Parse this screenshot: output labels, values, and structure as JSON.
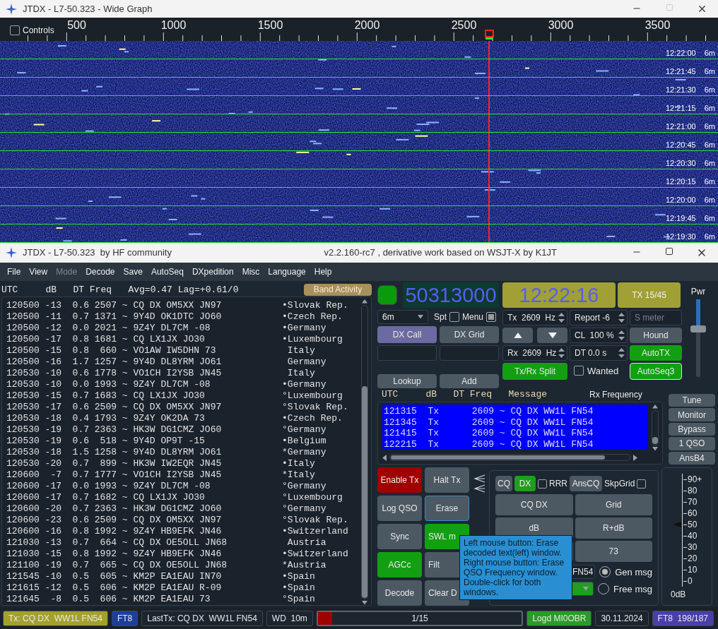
{
  "wide_graph": {
    "title": "JTDX - L7-50.323 - Wide Graph",
    "controls": {
      "label": "Controls",
      "checked": false
    },
    "scale_labels": [
      "500",
      "1000",
      "1500",
      "2000",
      "2500",
      "3000",
      "3500"
    ],
    "time_rows": [
      {
        "time": "12:22:00",
        "band": "6m"
      },
      {
        "time": "12:21:45",
        "band": "6m"
      },
      {
        "time": "12:21:30",
        "band": "6m"
      },
      {
        "time": "12:21:15",
        "band": "6m"
      },
      {
        "time": "12:21:00",
        "band": "6m"
      },
      {
        "time": "12:20:45",
        "band": "6m"
      },
      {
        "time": "12:20:30",
        "band": "6m"
      },
      {
        "time": "12:20:15",
        "band": "6m"
      },
      {
        "time": "12:20:00",
        "band": "6m"
      },
      {
        "time": "12:19:45",
        "band": "6m"
      },
      {
        "time": "12:19:30",
        "band": "6m"
      }
    ]
  },
  "main_window": {
    "title": "JTDX - L7-50.323  by HF community",
    "subtitle": "v2.2.160-rc7 , derivative work based on WSJT-X by K1JT"
  },
  "menu": [
    {
      "label": "File",
      "disabled": false
    },
    {
      "label": "View",
      "disabled": false
    },
    {
      "label": "Mode",
      "disabled": true
    },
    {
      "label": "Decode",
      "disabled": false
    },
    {
      "label": "Save",
      "disabled": false
    },
    {
      "label": "AutoSeq",
      "disabled": false
    },
    {
      "label": "DXpedition",
      "disabled": false
    },
    {
      "label": "Misc",
      "disabled": false
    },
    {
      "label": "Language",
      "disabled": false
    },
    {
      "label": "Help",
      "disabled": false
    }
  ],
  "band_activity": {
    "header": "UTC     dB   DT Freq   Avg=0.47 Lag=+0.61/0",
    "button": "Band Activity",
    "rows": [
      {
        "text": "120500 -13  0.6 2507 ~ CQ DX OM5XX JN97",
        "marker": "•",
        "country": "Slovak Rep."
      },
      {
        "text": "120500 -11  0.7 1371 ~ 9Y4D OK1DTC JO60",
        "marker": "•",
        "country": "Czech Rep."
      },
      {
        "text": "120500 -12  0.0 2021 ~ 9Z4Y DL7CM -08",
        "marker": "•",
        "country": "Germany"
      },
      {
        "text": "120500 -17  0.8 1681 ~ CQ LX1JX JO30",
        "marker": "•",
        "country": "Luxembourg"
      },
      {
        "text": "120500 -15  0.8  660 ~ VO1AW IW5DHN 73",
        "country": "Italy"
      },
      {
        "text": "120500 -16  1.7 1257 ~ 9Y4D DL8YRM JO61",
        "country": "Germany"
      },
      {
        "text": "120530 -10  0.6 1778 ~ VO1CH I2YSB JN45",
        "country": "Italy"
      },
      {
        "text": "120530 -10  0.0 1993 ~ 9Z4Y DL7CM -08",
        "marker": "•",
        "country": "Germany"
      },
      {
        "text": "120530 -15  0.7 1683 ~ CQ LX1JX JO30",
        "marker": "°",
        "country": "Luxembourg"
      },
      {
        "text": "120530 -17  0.6 2509 ~ CQ DX OM5XX JN97",
        "marker": "°",
        "country": "Slovak Rep."
      },
      {
        "text": "120530 -18  0.4 1793 ~ 9Z4Y OK2DA 73",
        "marker": "•",
        "country": "Czech Rep."
      },
      {
        "text": "120530 -19  0.7 2363 ~ HK3W DG1CMZ JO60",
        "marker": "°",
        "country": "Germany"
      },
      {
        "text": "120530 -19  0.6  518 ~ 9Y4D OP9T -15",
        "marker": "•",
        "country": "Belgium"
      },
      {
        "text": "120530 -18  1.5 1258 ~ 9Y4D DL8YRM JO61",
        "marker": "*",
        "country": "Germany"
      },
      {
        "text": "120530 -20  0.7  899 ~ HK3W IW2EQR JN45",
        "marker": "•",
        "country": "Italy"
      },
      {
        "text": "120600  -7  0.7 1777 ~ VO1CH I2YSB JN45",
        "marker": "*",
        "country": "Italy"
      },
      {
        "text": "120600 -17  0.0 1993 ~ 9Z4Y DL7CM -08",
        "marker": "°",
        "country": "Germany"
      },
      {
        "text": "120600 -17  0.7 1682 ~ CQ LX1JX JO30",
        "marker": "°",
        "country": "Luxembourg"
      },
      {
        "text": "120600 -20  0.7 2363 ~ HK3W DG1CMZ JO60",
        "marker": "°",
        "country": "Germany"
      },
      {
        "text": "120600 -23  0.6 2509 ~ CQ DX OM5XX JN97",
        "marker": "°",
        "country": "Slovak Rep."
      },
      {
        "text": "120600 -16  0.8 1992 ~ 9Z4Y HB9EFK JN46",
        "marker": "•",
        "country": "Switzerland"
      },
      {
        "text": "121030 -13  0.7  664 ~ CQ DX OE5OLL JN68",
        "country": "Austria"
      },
      {
        "text": "121030 -15  0.8 1992 ~ 9Z4Y HB9EFK JN46",
        "marker": "•",
        "country": "Switzerland"
      },
      {
        "text": "121100 -19  0.7  665 ~ CQ DX OE5OLL JN68",
        "marker": "*",
        "country": "Austria"
      },
      {
        "text": "121545 -10  0.5  605 ~ KM2P EA1EAU IN70",
        "marker": "•",
        "country": "Spain"
      },
      {
        "text": "121615 -12  0.5  606 ~ KM2P EA1EAU R-09",
        "marker": "•",
        "country": "Spain"
      },
      {
        "text": "121645  -8  0.5  606 ~ KM2P EA1EAU 73",
        "marker": "°",
        "country": "Spain"
      }
    ]
  },
  "controls": {
    "monitor_on": true,
    "dial_frequency": "50313000",
    "clock": "12:22:16",
    "tx_period": "TX 15/45",
    "band": "6m",
    "spot": {
      "label": "Spt",
      "checked": false
    },
    "menu_toggle": {
      "label": "Menu",
      "checked": true
    },
    "dx_call": "DX Call",
    "dx_grid": "DX Grid",
    "lookup": "Lookup",
    "add": "Add",
    "tx_freq": "Tx  2609  Hz",
    "rx_freq": "Rx  2609  Hz",
    "report": "Report -6",
    "s_meter": {
      "placeholder": "S meter"
    },
    "cl": "CL  100 %",
    "dt": "DT 0.0 s",
    "hound": {
      "label": "Hound",
      "on": false
    },
    "auto_tx": {
      "label": "AutoTX",
      "on": true
    },
    "split": {
      "label": "Tx/Rx Split",
      "on": true
    },
    "wanted": {
      "label": "Wanted",
      "checked": false
    },
    "auto_seq": {
      "label": "AutoSeq3",
      "on": true
    },
    "power": {
      "label": "Pwr"
    }
  },
  "rx_frequency": {
    "header": "UTC     dB   DT Freq   Message",
    "title": "Rx Frequency",
    "rows": [
      "121315  Tx      2609 ~ CQ DX WW1L FN54",
      "121345  Tx      2609 ~ CQ DX WW1L FN54",
      "121415  Tx      2609 ~ CQ DX WW1L FN54",
      "122215  Tx      2609 ~ CQ DX WW1L FN54"
    ]
  },
  "side_buttons": [
    "Tune",
    "Monitor",
    "Bypass",
    "1 QSO",
    "AnsB4"
  ],
  "action_buttons": [
    {
      "label": "Enable Tx",
      "kind": "danger",
      "focused": false
    },
    {
      "label": "Halt Tx",
      "kind": "plain",
      "focused": false
    },
    {
      "label": "Log QSO",
      "kind": "plain",
      "focused": false
    },
    {
      "label": "Erase",
      "kind": "plain",
      "focused": true
    },
    {
      "label": "Sync",
      "kind": "plain",
      "focused": false
    },
    {
      "label": "SWL m",
      "kind": "active",
      "focused": false
    },
    {
      "label": "AGCc",
      "kind": "active",
      "focused": false
    },
    {
      "label": "Filt",
      "kind": "plain",
      "focused": false
    },
    {
      "label": "Decode",
      "kind": "plain",
      "focused": false
    },
    {
      "label": "Clear D",
      "kind": "plain",
      "focused": false
    }
  ],
  "generator": {
    "toggles": [
      {
        "label": "CQ",
        "selected": false
      },
      {
        "label": "DX",
        "selected": true
      }
    ],
    "rrr": {
      "label": "RRR",
      "checked": false
    },
    "ans_cq": "AnsCQ",
    "skip_grid": {
      "label": "SkpGrid",
      "checked": false
    },
    "messages": [
      {
        "kind": "text",
        "label": "CQ DX"
      },
      {
        "kind": "text",
        "label": "Grid"
      },
      {
        "kind": "text",
        "label": "dB"
      },
      {
        "kind": "text",
        "label": "R+dB"
      },
      {
        "kind": "blank"
      },
      {
        "kind": "text",
        "label": "73"
      }
    ],
    "free_text": "FN54",
    "modes": [
      {
        "label": "Gen msg",
        "selected": true
      },
      {
        "label": "Free msg",
        "selected": false
      }
    ]
  },
  "meter": {
    "scale": [
      "90+",
      "80",
      "70",
      "60",
      "50",
      "40",
      "30",
      "20",
      "10",
      "0"
    ],
    "unit": "0dB",
    "level": 0.55
  },
  "tooltip": "Left mouse button: Erase decoded text(left) window. Right mouse button: Erase QSO Frequency window. Double-click for both windows.",
  "status_bar": [
    {
      "kind": "label",
      "text": "Tx: CQ DX  WW1L FN54",
      "color": "#a3a12e"
    },
    {
      "kind": "label",
      "text": "FT8",
      "color": "#1c3f9c"
    },
    {
      "kind": "label",
      "text": "LastTx: CQ DX  WW1L FN54",
      "color": "#1c252e"
    },
    {
      "kind": "label",
      "text": "WD  10m",
      "color": "#1c252e"
    },
    {
      "kind": "progress",
      "text": "1/15",
      "level": 0.07
    },
    {
      "kind": "label",
      "text": "Logd MI0OBR",
      "color": "#2a9a2a"
    },
    {
      "kind": "label",
      "text": "30.11.2024",
      "color": "#1c252e"
    },
    {
      "kind": "label",
      "text": "FT8  198/187",
      "color": "#4a3fa8"
    }
  ]
}
